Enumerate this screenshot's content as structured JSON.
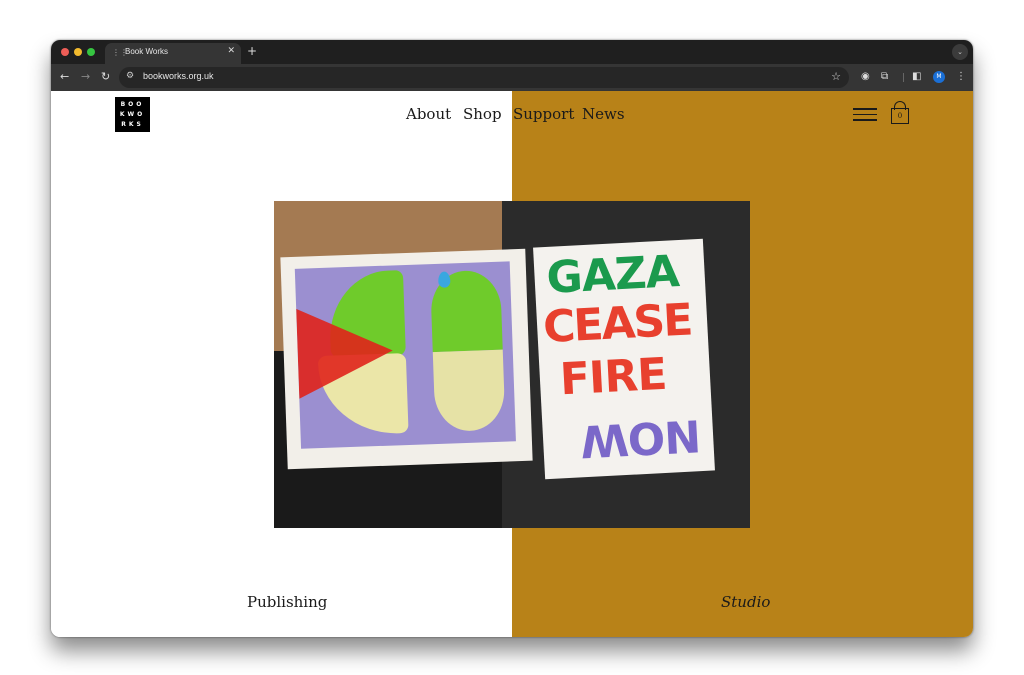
{
  "browser": {
    "tab_title": "Book Works",
    "tab_favicon": "grid-icon",
    "url": "bookworks.org.uk",
    "profile_initial": "M",
    "icons": [
      "back-icon",
      "forward-icon",
      "reload-icon",
      "site-settings-icon",
      "bookmark-star-icon",
      "extension-icon",
      "puzzle-icon",
      "side-panel-icon",
      "profile-icon",
      "more-menu-icon"
    ]
  },
  "site": {
    "logo_lines": [
      "BOO",
      "KWO",
      "RKS"
    ],
    "nav": [
      {
        "label": "About"
      },
      {
        "label": "Shop"
      },
      {
        "label": "Support"
      },
      {
        "label": "News"
      }
    ],
    "cart_count": "0",
    "hero": {
      "poster_lines": [
        "GAZA",
        "CEASE",
        "FIRE",
        "NOW"
      ]
    },
    "captions": {
      "left": "Publishing",
      "right": "Studio"
    },
    "colors": {
      "left_bg": "#ffffff",
      "right_bg": "#b88218"
    }
  }
}
